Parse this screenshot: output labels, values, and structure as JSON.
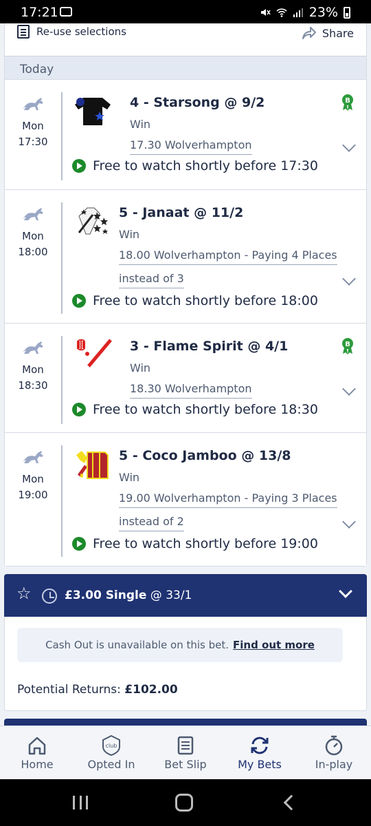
{
  "status_bar": {
    "time": "17:21",
    "battery": "23%"
  },
  "header": {
    "reuse_label": "Re-use selections",
    "share_label": "Share"
  },
  "section": {
    "label": "Today"
  },
  "selections": [
    {
      "day": "Mon",
      "time": "17:30",
      "title": "4 - Starsong @ 9/2",
      "type": "Win",
      "race": "17.30 Wolverhampton",
      "race_extra": "",
      "watch": "Free to watch shortly before 17:30",
      "badge": "B"
    },
    {
      "day": "Mon",
      "time": "18:00",
      "title": "5 - Janaat @ 11/2",
      "type": "Win",
      "race": "18.00 Wolverhampton - Paying 4 Places",
      "race_extra": "instead of 3",
      "watch": "Free to watch shortly before 18:00",
      "badge": ""
    },
    {
      "day": "Mon",
      "time": "18:30",
      "title": "3 - Flame Spirit @ 4/1",
      "type": "Win",
      "race": "18.30 Wolverhampton",
      "race_extra": "",
      "watch": "Free to watch shortly before 18:30",
      "badge": "B"
    },
    {
      "day": "Mon",
      "time": "19:00",
      "title": "5 - Coco Jamboo @ 13/8",
      "type": "Win",
      "race": "19.00 Wolverhampton - Paying 3 Places",
      "race_extra": "instead of 2",
      "watch": "Free to watch shortly before 19:00",
      "badge": ""
    }
  ],
  "bet": {
    "stake_label": "£3.00 Single",
    "odds": "@ 33/1",
    "cashout_text": "Cash Out is unavailable on this bet.",
    "find_out_more": "Find out more",
    "returns_label": "Potential Returns:",
    "returns_value": "£102.00"
  },
  "nav": [
    {
      "label": "Home",
      "icon": "home-icon"
    },
    {
      "label": "Opted In",
      "icon": "club-icon",
      "icon_text": "club"
    },
    {
      "label": "Bet Slip",
      "icon": "betslip-icon"
    },
    {
      "label": "My Bets",
      "icon": "mybets-icon"
    },
    {
      "label": "In-play",
      "icon": "stopwatch-icon"
    }
  ],
  "colors": {
    "primary": "#1f3272",
    "play_green": "#1c8a2a",
    "badge_green": "#2e9b3c"
  }
}
